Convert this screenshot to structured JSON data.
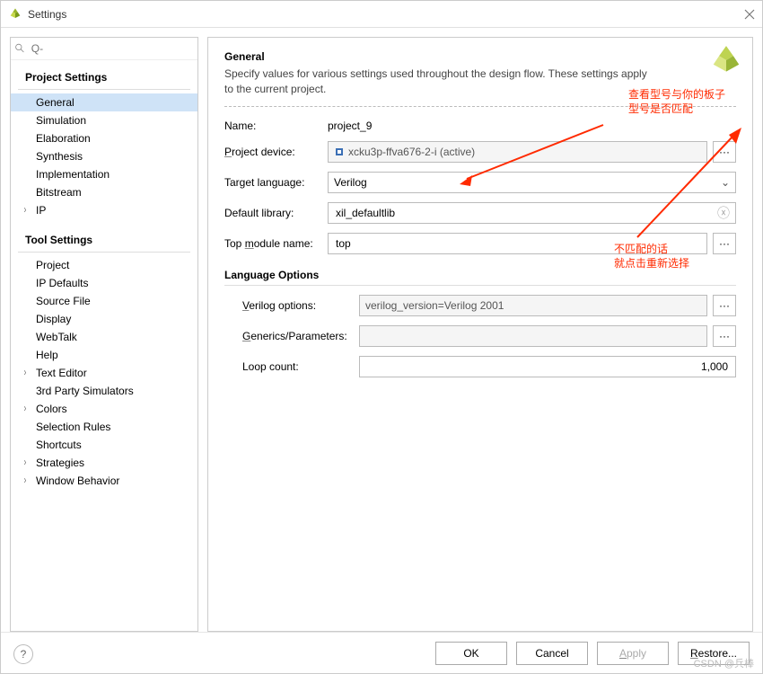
{
  "window": {
    "title": "Settings"
  },
  "search": {
    "placeholder": "Q-"
  },
  "nav": {
    "project_settings_header": "Project Settings",
    "tool_settings_header": "Tool Settings",
    "project_items": {
      "general": "General",
      "simulation": "Simulation",
      "elaboration": "Elaboration",
      "synthesis": "Synthesis",
      "implementation": "Implementation",
      "bitstream": "Bitstream",
      "ip": "IP"
    },
    "tool_items": {
      "project": "Project",
      "ip_defaults": "IP Defaults",
      "source_file": "Source File",
      "display": "Display",
      "webtalk": "WebTalk",
      "help": "Help",
      "text_editor": "Text Editor",
      "thirdparty": "3rd Party Simulators",
      "colors": "Colors",
      "selection_rules": "Selection Rules",
      "shortcuts": "Shortcuts",
      "strategies": "Strategies",
      "window_behavior": "Window Behavior"
    }
  },
  "main": {
    "title": "General",
    "desc": "Specify values for various settings used throughout the design flow. These settings apply to the current project.",
    "name_label": "Name:",
    "name_value": "project_9",
    "device_label": "Project device:",
    "device_value": "xcku3p-ffva676-2-i (active)",
    "lang_label": "Target language:",
    "lang_value": "Verilog",
    "lib_label": "Default library:",
    "lib_value": "xil_defaultlib",
    "top_label": "Top module name:",
    "top_value": "top",
    "langopt_header": "Language Options",
    "verilog_label": "Verilog options:",
    "verilog_value": "verilog_version=Verilog 2001",
    "generics_label": "Generics/Parameters:",
    "generics_value": "",
    "loop_label": "Loop count:",
    "loop_value": "1,000"
  },
  "annotations": {
    "top1": "查看型号与你的板子",
    "top2": "型号是否匹配",
    "bot1": "不匹配的话",
    "bot2": "就点击重新选择"
  },
  "footer": {
    "ok": "OK",
    "cancel": "Cancel",
    "apply": "Apply",
    "restore": "Restore..."
  },
  "watermark": "CSDN @兵棒"
}
